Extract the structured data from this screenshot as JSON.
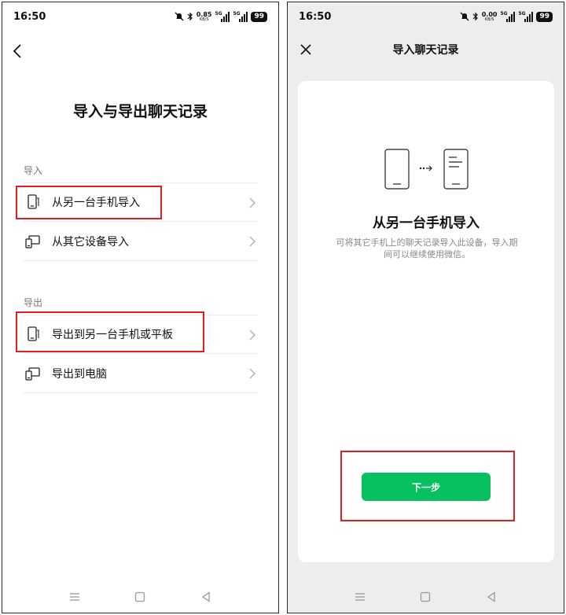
{
  "status_bar": {
    "time": "16:50",
    "left_speed": "0.85",
    "right_speed": "0.00",
    "speed_unit": "KB/S",
    "network_tag": "5G",
    "battery": "99"
  },
  "left_screen": {
    "title": "导入与导出聊天记录",
    "import_section": {
      "label": "导入",
      "items": [
        {
          "label": "从另一台手机导入",
          "icon": "phone-icon"
        },
        {
          "label": "从其它设备导入",
          "icon": "devices-icon"
        }
      ]
    },
    "export_section": {
      "label": "导出",
      "items": [
        {
          "label": "导出到另一台手机或平板",
          "icon": "phone-icon"
        },
        {
          "label": "导出到电脑",
          "icon": "devices-icon"
        }
      ]
    }
  },
  "right_screen": {
    "title": "导入聊天记录",
    "card_title": "从另一台手机导入",
    "card_description": "可将其它手机上的聊天记录导入此设备，导入期间可以继续使用微信。",
    "next_button": "下一步"
  },
  "colors": {
    "accent": "#07c160",
    "highlight": "#e02020",
    "right_background": "#ededed"
  }
}
